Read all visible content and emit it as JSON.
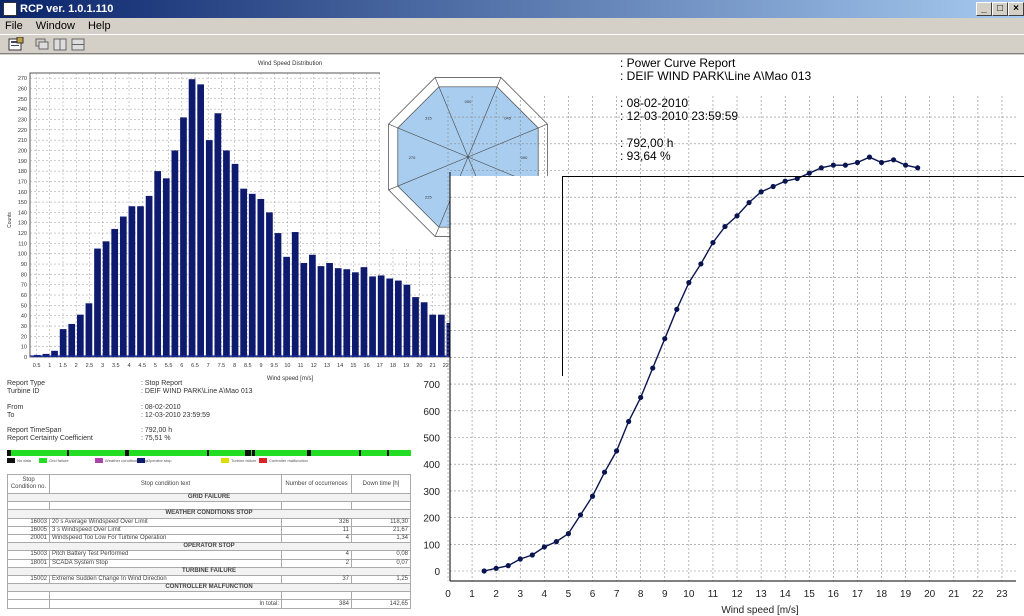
{
  "window": {
    "title": "RCP   ver. 1.0.1.110",
    "min": "_",
    "restore": "□",
    "close": "×"
  },
  "menu": [
    "File",
    "Window",
    "Help"
  ],
  "report": {
    "title": ": Power Curve Report",
    "turbine": ": DEIF WIND PARK\\Line A\\Mao 013",
    "from": ": 08-02-2010",
    "to": ": 12-03-2010 23:59:59",
    "timespan": ": 792,00 h",
    "coefficient": ": 93,64 %"
  },
  "histogram": {
    "title": "Wind Speed Distribution",
    "ylabel": "Counts",
    "xlabel": "Wind speed [m/s]",
    "yticks": [
      "0",
      "10",
      "20",
      "30",
      "40",
      "50",
      "60",
      "70",
      "80",
      "90",
      "100",
      "110",
      "120",
      "130",
      "140",
      "150",
      "160",
      "170",
      "180",
      "190",
      "200",
      "210",
      "220",
      "230",
      "240",
      "250",
      "260",
      "270"
    ],
    "xticks": [
      "0.5",
      "1",
      "1.5",
      "2",
      "2.5",
      "3",
      "3.5",
      "4",
      "4.5",
      "5",
      "5.5",
      "6",
      "6.5",
      "7",
      "7.5",
      "8",
      "8.5",
      "9",
      "9.5",
      "10",
      "11",
      "12",
      "13",
      "14",
      "15",
      "16",
      "17",
      "18",
      "19",
      "20",
      "21",
      "22",
      "23",
      "24",
      "25",
      "26",
      "27",
      "28",
      "29",
      "30"
    ]
  },
  "rose": {
    "sectors": [
      "000",
      "045",
      "090",
      "135",
      "180",
      "225",
      "270",
      "315"
    ]
  },
  "info": {
    "rows": [
      {
        "label": "Report Type",
        "value": ": Stop Report"
      },
      {
        "label": "Turbine ID",
        "value": ": DEIF WIND PARK\\Line A\\Mao 013"
      },
      {
        "label": "From",
        "value": ": 08-02-2010"
      },
      {
        "label": "To",
        "value": ": 12-03-2010 23:59:59"
      },
      {
        "label": "Report TimeSpan",
        "value": ": 792,00 h"
      },
      {
        "label": "Report Certainty Coefficient",
        "value": ": 75,51 %"
      }
    ]
  },
  "stop_legend": [
    "No data",
    "Grid failure",
    "Weather conditions stop",
    "Operator stop",
    "Turbine failure",
    "Controller malfunction"
  ],
  "stop_table": {
    "headers": [
      "Stop Condition no.",
      "Stop condition text",
      "Number of occurrences",
      "Down time [h]"
    ],
    "rows": [
      {
        "type": "group",
        "text": "GRID FAILURE"
      },
      {
        "type": "row",
        "no": "",
        "text": "",
        "occ": "",
        "down": ""
      },
      {
        "type": "group",
        "text": "WEATHER CONDITIONS STOP"
      },
      {
        "type": "row",
        "no": "16003",
        "text": "20 s Average Windspeed Over Limit",
        "occ": "326",
        "down": "118,30"
      },
      {
        "type": "row",
        "no": "16005",
        "text": "3 s Windspeed Over Limit",
        "occ": "11",
        "down": "21,67"
      },
      {
        "type": "row",
        "no": "20001",
        "text": "Windspeed Too Low For Turbine Operation",
        "occ": "4",
        "down": "1,34"
      },
      {
        "type": "group",
        "text": "OPERATOR STOP"
      },
      {
        "type": "row",
        "no": "15003",
        "text": "Pitch Battery Test Performed",
        "occ": "4",
        "down": "0,08"
      },
      {
        "type": "row",
        "no": "18001",
        "text": "SCADA System Stop",
        "occ": "2",
        "down": "0,07"
      },
      {
        "type": "group",
        "text": "TURBINE FAILURE"
      },
      {
        "type": "row",
        "no": "15002",
        "text": "Extreme Sudden Change In Wind Direction",
        "occ": "37",
        "down": "1,25"
      },
      {
        "type": "group",
        "text": "CONTROLLER MALFUNCTION"
      },
      {
        "type": "row",
        "no": "",
        "text": "",
        "occ": "",
        "down": ""
      },
      {
        "type": "row",
        "no": "",
        "text": "In total:",
        "occ": "384",
        "down": "142,65"
      }
    ]
  },
  "power_curve": {
    "xlabel": "Wind speed [m/s]",
    "xticks": [
      "0",
      "1",
      "2",
      "3",
      "4",
      "5",
      "6",
      "7",
      "8",
      "9",
      "10",
      "11",
      "12",
      "13",
      "14",
      "15",
      "16",
      "17",
      "18",
      "19",
      "20",
      "21",
      "22",
      "23"
    ],
    "yticks": [
      "0",
      "100",
      "200",
      "300",
      "400",
      "500",
      "600",
      "700"
    ]
  },
  "chart_data": [
    {
      "type": "bar",
      "title": "Wind Speed Distribution",
      "xlabel": "Wind speed [m/s]",
      "ylabel": "Counts",
      "ylim": [
        0,
        275
      ],
      "grid": true,
      "values": [
        2,
        3,
        6,
        27,
        32,
        41,
        52,
        105,
        112,
        124,
        136,
        146,
        146,
        156,
        180,
        173,
        200,
        232,
        269,
        264,
        210,
        236,
        200,
        187,
        163,
        158,
        153,
        140,
        120,
        97,
        121,
        91,
        99,
        88,
        91,
        86,
        85,
        82,
        87,
        78,
        79,
        76,
        74,
        70,
        58,
        53,
        41,
        41,
        33,
        6,
        5,
        2,
        1,
        1,
        1,
        1,
        1,
        1,
        1,
        1
      ]
    },
    {
      "type": "line",
      "xlabel": "Wind speed [m/s]",
      "ylim": [
        -20,
        780
      ],
      "xlim": [
        0,
        23.5
      ],
      "grid": true,
      "x": [
        1.5,
        2,
        2.5,
        3,
        3.5,
        4,
        4.5,
        5,
        5.5,
        6,
        6.5,
        7,
        7.5,
        8,
        8.5,
        9,
        9.5,
        10,
        10.5,
        11,
        11.5,
        12,
        12.5,
        13,
        13.5,
        14,
        14.5,
        15,
        15.5,
        16,
        16.5,
        17,
        17.5,
        18,
        18.5,
        19,
        19.5
      ],
      "y": [
        0,
        10,
        20,
        45,
        60,
        90,
        110,
        140,
        210,
        280,
        370,
        450,
        560,
        650,
        760,
        870,
        980,
        1080,
        1150,
        1230,
        1290,
        1330,
        1380,
        1420,
        1440,
        1460,
        1470,
        1490,
        1510,
        1520,
        1520,
        1530,
        1550,
        1530,
        1540,
        1520,
        1510
      ]
    }
  ]
}
